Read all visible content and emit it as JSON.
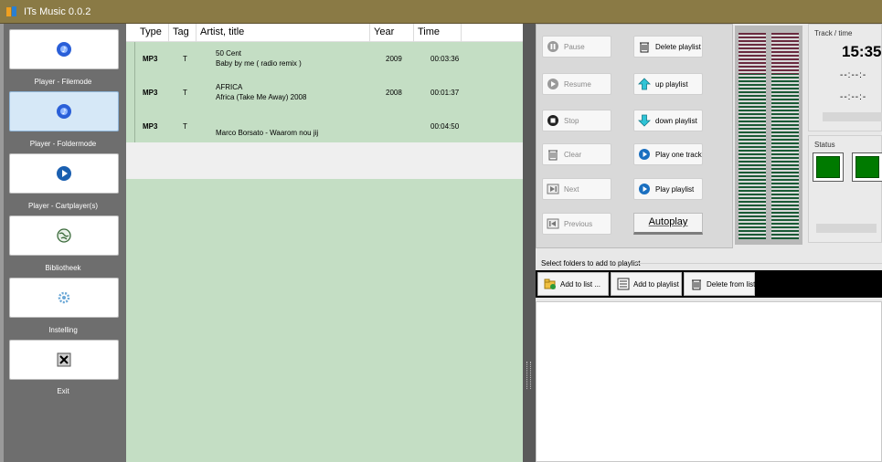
{
  "app": {
    "title": "ITs Music 0.0.2"
  },
  "sidebar": {
    "items": [
      {
        "label": "Player - Filemode",
        "icon": "music-note-icon"
      },
      {
        "label": "Player - Foldermode",
        "icon": "music-note-icon",
        "active": true
      },
      {
        "label": "Player - Cartplayer(s)",
        "icon": "play-icon"
      },
      {
        "label": "Bibliotheek",
        "icon": "globe-icon"
      },
      {
        "label": "Instelling",
        "icon": "gear-icon"
      },
      {
        "label": "Exit",
        "icon": "close-icon"
      }
    ]
  },
  "playlist": {
    "columns": [
      "Type",
      "Tag",
      "Artist, title",
      "Year",
      "Time"
    ],
    "rows": [
      {
        "type": "MP3",
        "tag": "T",
        "artist": "50 Cent",
        "title": "Baby by me ( radio remix )",
        "year": "2009",
        "time": "00:03:36"
      },
      {
        "type": "MP3",
        "tag": "T",
        "artist": "AFRICA",
        "title": "Africa (Take Me Away) 2008",
        "year": "2008",
        "time": "00:01:37"
      },
      {
        "type": "MP3",
        "tag": "T",
        "artist": "",
        "title": "Marco Borsato - Waarom nou jij",
        "year": "",
        "time": "00:04:50"
      }
    ]
  },
  "controls": {
    "pause": "Pause",
    "resume": "Resume",
    "stop": "Stop",
    "clear": "Clear",
    "next": "Next",
    "previous": "Previous",
    "delete_playlist": "Delete playlist",
    "up_playlist": "up playlist",
    "down_playlist": "down playlist",
    "play_one_track": "Play one track",
    "play_playlist": "Play playlist",
    "autoplay": "Autoplay"
  },
  "track": {
    "title": "Track / time",
    "clock": "15:35",
    "elapsed": "--:--:-",
    "remaining": "--:--:-"
  },
  "status": {
    "title": "Status"
  },
  "folders": {
    "title": "Select folders to add to playlist",
    "add_to_list": "Add to list ...",
    "add_to_playlist": "Add to playlist",
    "delete_from_list": "Delete from list"
  },
  "colors": {
    "titlebar": "#8a7a45",
    "list_bg": "#c4dec4",
    "status_green": "#007a00"
  }
}
